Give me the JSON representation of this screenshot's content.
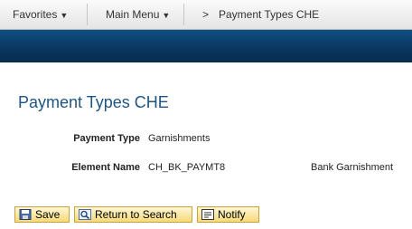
{
  "nav": {
    "favorites": "Favorites",
    "main_menu": "Main Menu",
    "breadcrumb_sep": ">",
    "breadcrumb_current": "Payment Types CHE"
  },
  "page": {
    "title": "Payment Types CHE"
  },
  "fields": {
    "payment_type": {
      "label": "Payment Type",
      "value": "Garnishments"
    },
    "element_name": {
      "label": "Element Name",
      "value": "CH_BK_PAYMT8",
      "description": "Bank Garnishment"
    }
  },
  "buttons": {
    "save": "Save",
    "return_to_search": "Return to Search",
    "notify": "Notify"
  },
  "icons": {
    "caret": "chevron-down-icon",
    "save": "save-icon",
    "search": "search-icon",
    "notify": "notify-icon"
  },
  "colors": {
    "header_band": "#0a365e",
    "title": "#1f5585",
    "button_fill": "#f6d978"
  }
}
